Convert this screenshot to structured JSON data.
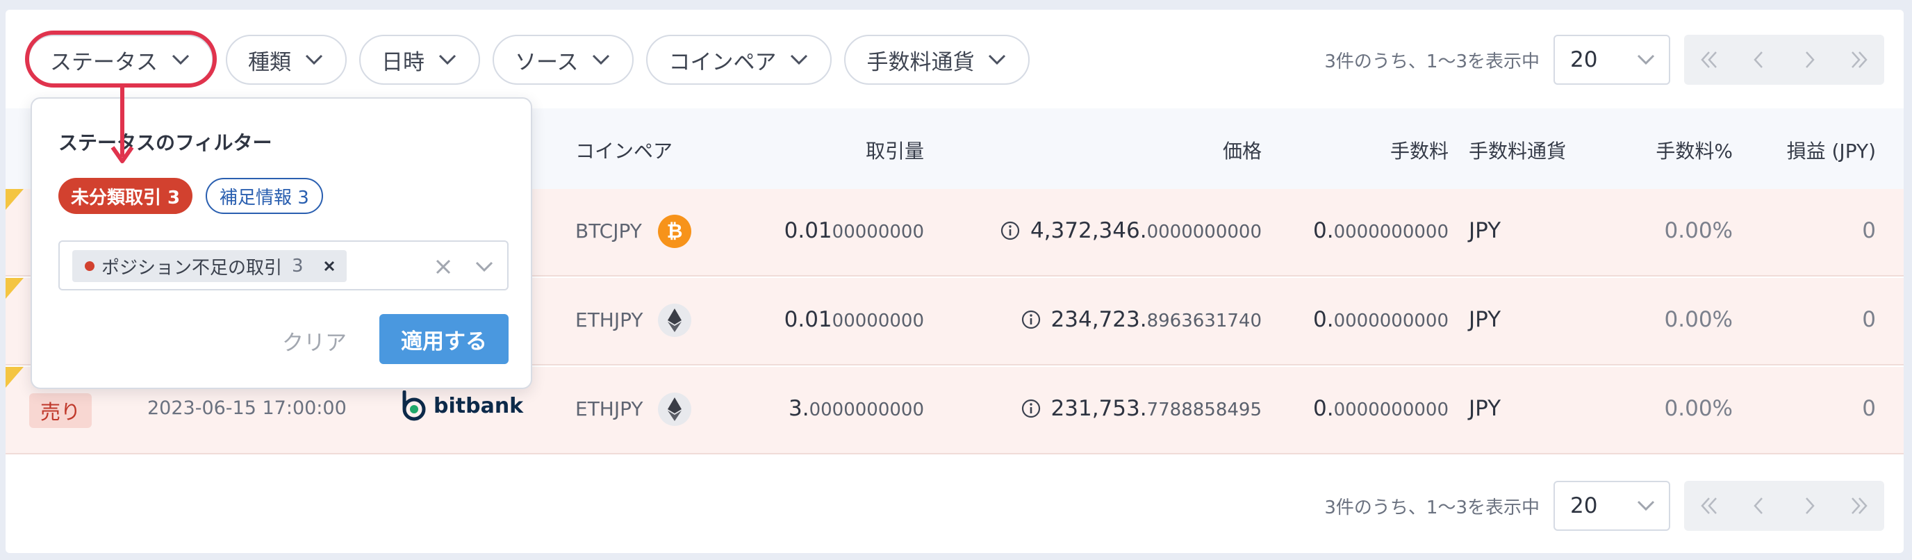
{
  "filters": [
    {
      "label": "ステータス"
    },
    {
      "label": "種類"
    },
    {
      "label": "日時"
    },
    {
      "label": "ソース"
    },
    {
      "label": "コインペア"
    },
    {
      "label": "手数料通貨"
    }
  ],
  "pagination": {
    "range_text": "3件のうち、1〜3を表示中",
    "per_page": "20"
  },
  "table": {
    "headers": {
      "pair": "コインペア",
      "amount": "取引量",
      "price": "価格",
      "fee": "手数料",
      "fee_currency": "手数料通貨",
      "fee_pct": "手数料%",
      "pnl": "損益 (JPY)"
    },
    "rows": [
      {
        "pair": "BTCJPY",
        "amount_int": "0.01",
        "amount_dec": "00000000",
        "price_int": "4,372,346.",
        "price_dec": "0000000000",
        "fee_int": "0.",
        "fee_dec": "0000000000",
        "fee_currency": "JPY",
        "fee_pct": "0.00%",
        "pnl": "0",
        "coin_icon": "bitcoin-icon",
        "coin_color": "#f7931a"
      },
      {
        "pair": "ETHJPY",
        "amount_int": "0.01",
        "amount_dec": "00000000",
        "price_int": "234,723.",
        "price_dec": "8963631740",
        "fee_int": "0.",
        "fee_dec": "0000000000",
        "fee_currency": "JPY",
        "fee_pct": "0.00%",
        "pnl": "0",
        "coin_icon": "ethereum-icon",
        "coin_color": "#e8e9ed"
      },
      {
        "side": "売り",
        "date": "2023-06-15 17:00:00",
        "exchange": "bitbank",
        "pair": "ETHJPY",
        "amount_int": "3.",
        "amount_dec": "0000000000",
        "price_int": "231,753.",
        "price_dec": "7788858495",
        "fee_int": "0.",
        "fee_dec": "0000000000",
        "fee_currency": "JPY",
        "fee_pct": "0.00%",
        "pnl": "0",
        "coin_icon": "ethereum-icon",
        "coin_color": "#e8e9ed"
      }
    ]
  },
  "popover": {
    "title": "ステータスのフィルター",
    "tag_unclassified": "未分類取引 3",
    "tag_supplement": "補足情報 3",
    "selected_chip": {
      "label": "ポジション不足の取引",
      "count": "3"
    },
    "clear_label": "クリア",
    "apply_label": "適用する"
  },
  "colors": {
    "accent_red": "#e0334d",
    "apply_blue": "#4a98df",
    "row_bg": "#fdf1ef",
    "bitcoin": "#f7931a"
  }
}
